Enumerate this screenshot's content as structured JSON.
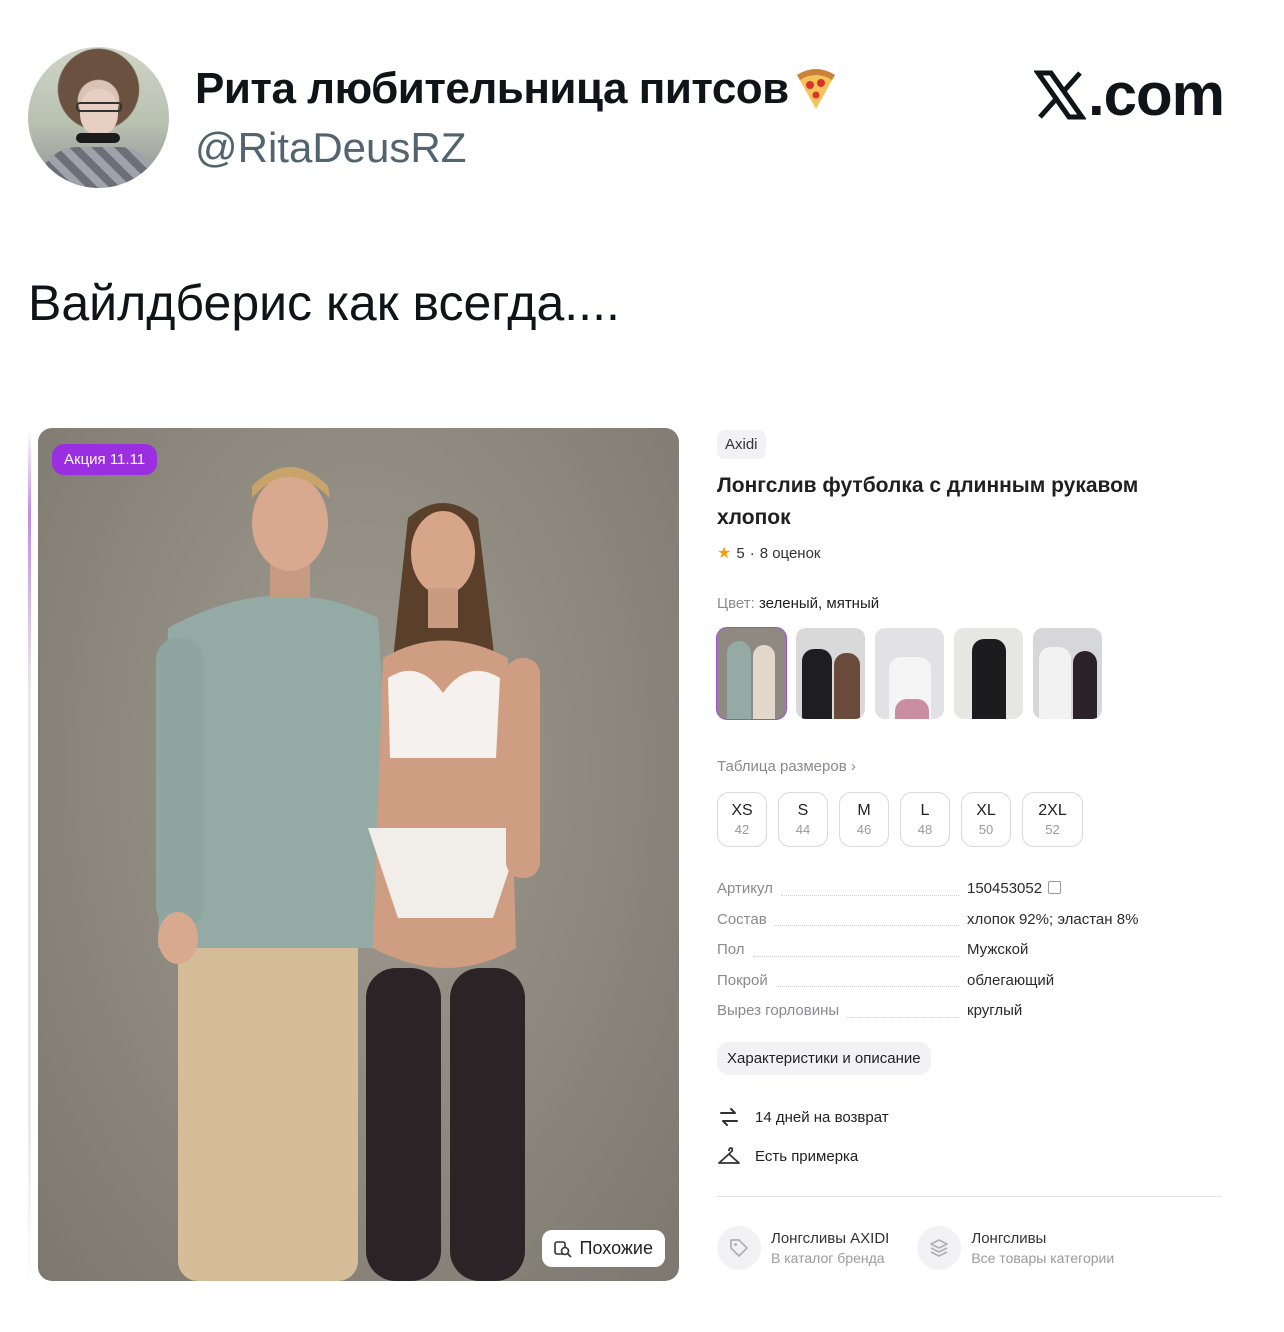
{
  "tweet": {
    "display_name": "Рита любительница питсов",
    "display_name_emoji": "pizza-emoji",
    "handle": "@RitaDeusRZ",
    "source_logo": ".com",
    "text": "Вайлдберис как всегда...."
  },
  "product": {
    "promo_badge": "Акция 11.11",
    "similar_button": "Похожие",
    "brand": "Axidi",
    "title": "Лонгслив футболка с длинным рукавом хлопок",
    "rating_value": "5",
    "rating_sep": "·",
    "rating_count": "8 оценок",
    "color_label": "Цвет:",
    "color_value": "зеленый, мятный",
    "size_table_link": "Таблица размеров",
    "sizes": [
      {
        "label": "XS",
        "ru": "42"
      },
      {
        "label": "S",
        "ru": "44"
      },
      {
        "label": "M",
        "ru": "46"
      },
      {
        "label": "L",
        "ru": "48"
      },
      {
        "label": "XL",
        "ru": "50"
      },
      {
        "label": "2XL",
        "ru": "52"
      }
    ],
    "specs": [
      {
        "key": "Артикул",
        "value": "150453052"
      },
      {
        "key": "Состав",
        "value": "хлопок 92%; эластан 8%"
      },
      {
        "key": "Пол",
        "value": "Мужской"
      },
      {
        "key": "Покрой",
        "value": "облегающий"
      },
      {
        "key": "Вырез горловины",
        "value": "круглый"
      }
    ],
    "characteristics_button": "Характеристики и описание",
    "return_text": "14 дней на возврат",
    "fitting_text": "Есть примерка",
    "brand_link_title": "Лонгсливы AXIDI",
    "brand_link_sub": "В каталог бренда",
    "category_link_title": "Лонгсливы",
    "category_link_sub": "Все товары категории"
  },
  "colors": {
    "accent": "#9b2ee0",
    "handle_gray": "#536471",
    "star": "#f59e0b"
  }
}
